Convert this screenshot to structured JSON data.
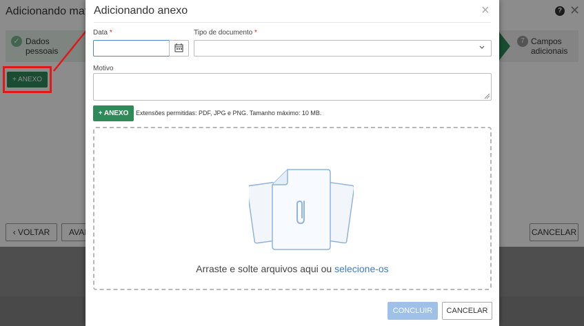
{
  "background": {
    "title": "Adicionando matrí",
    "help_icon": "?",
    "close_icon": "✕",
    "steps": [
      {
        "label_line1": "Dados",
        "label_line2": "pessoais"
      },
      {
        "number": "7",
        "label_line1": "Campos",
        "label_line2": "adicionais"
      }
    ],
    "anexo_button": "+ ANEXO",
    "voltar_button": "‹ VOLTAR",
    "avancar_button": "AVAN",
    "cancelar_button": "CANCELAR"
  },
  "modal": {
    "title": "Adicionando anexo",
    "close_icon": "×",
    "date_label": "Data",
    "date_required": "*",
    "date_value": "",
    "doc_type_label": "Tipo de documento",
    "doc_type_required": "*",
    "doc_type_value": "",
    "motivo_label": "Motivo",
    "motivo_value": "",
    "anexo_button": "+ ANEXO",
    "extensions_text": "Extensões permitidas: PDF, JPG e PNG. Tamanho máximo: 10 MB.",
    "dropzone_text": "Arraste e solte arquivos aqui ou ",
    "dropzone_link": "selecione-os",
    "concluir_button": "CONCLUIR",
    "cancelar_button": "CANCELAR"
  },
  "colors": {
    "primary_green": "#2f8a5a",
    "link_blue": "#3a7cc7",
    "disabled_blue": "#9fc1e8",
    "highlight_red": "#e01818"
  }
}
